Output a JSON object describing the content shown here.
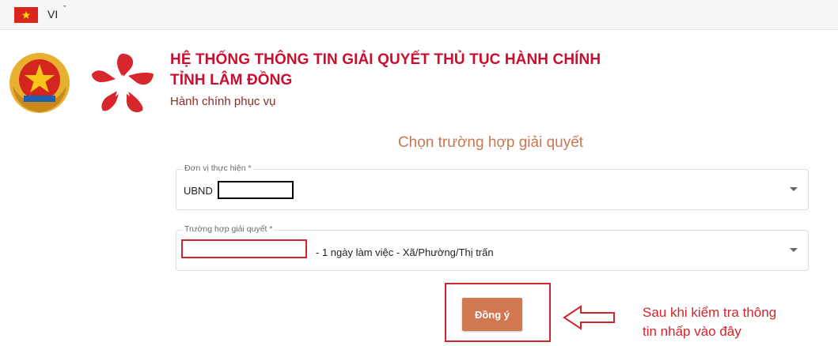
{
  "topbar": {
    "language_code": "VI",
    "flag_color": "#da251d"
  },
  "header": {
    "title_line1": "HỆ THỐNG THÔNG TIN GIẢI QUYẾT THỦ TỤC HÀNH CHÍNH",
    "title_line2": "TỈNH LÂM ĐỒNG",
    "slogan": "Hành chính phục vụ",
    "brand_color": "#c8102e"
  },
  "form": {
    "heading": "Chọn trường hợp giải quyết",
    "unit_field": {
      "label": "Đơn vị thực hiện *",
      "value": "UBND"
    },
    "case_field": {
      "label": "Trường hợp giải quyết *",
      "value": "- 1 ngày làm việc - Xã/Phường/Thị trấn"
    },
    "submit_label": "Đồng ý",
    "accent_color": "#d17852"
  },
  "annotation": {
    "note_line1": "Sau khi kiểm tra thông",
    "note_line2": "tin nhấp vào đây",
    "highlight_color": "#d0252d"
  }
}
